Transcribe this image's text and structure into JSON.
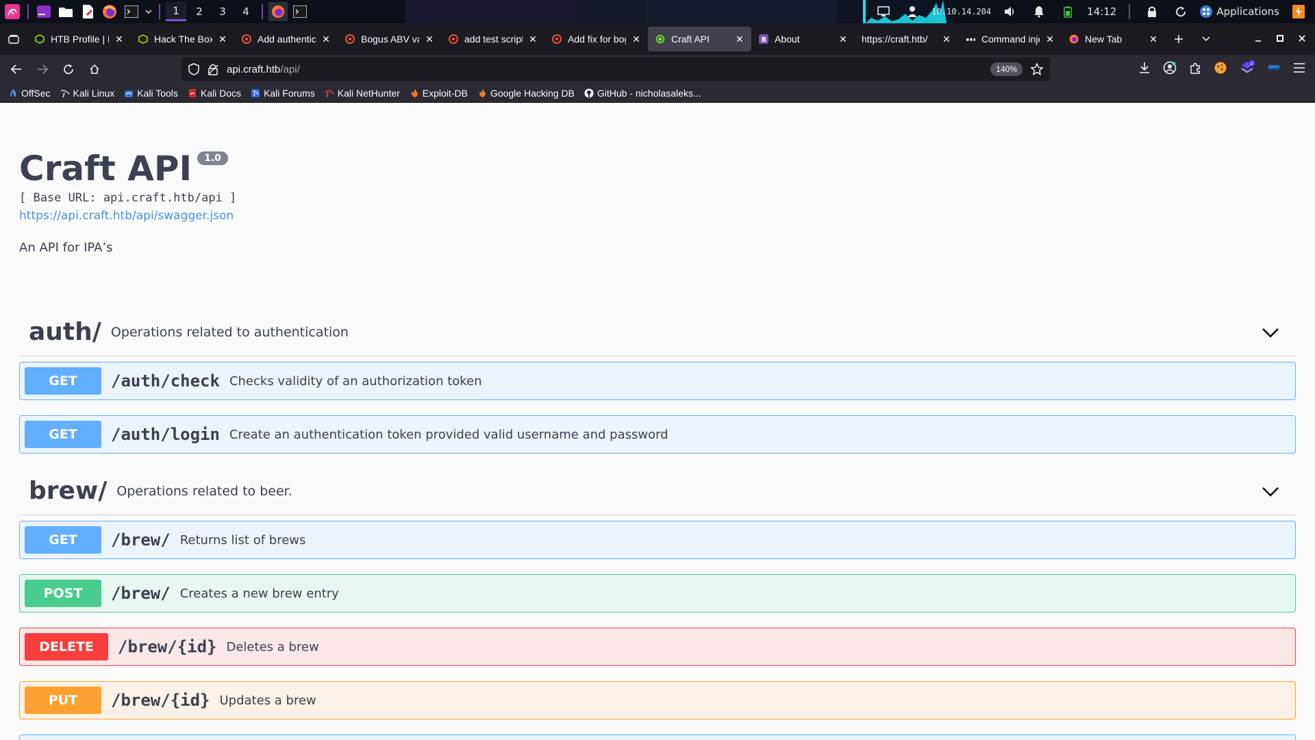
{
  "system_bar": {
    "workspaces": [
      "1",
      "2",
      "3",
      "4"
    ],
    "ip": "10.10.14.204",
    "time": "14:12",
    "apps_label": "Applications"
  },
  "tabs": [
    {
      "label": "HTB Profile | H",
      "icon": "cube-icon",
      "color": "#9fef00"
    },
    {
      "label": "Hack The Box :",
      "icon": "cube-icon",
      "color": "#9fef00"
    },
    {
      "label": "Add authentic",
      "icon": "gogs-icon",
      "color": "#f05133"
    },
    {
      "label": "Bogus ABV val",
      "icon": "gogs-icon",
      "color": "#f05133"
    },
    {
      "label": "add test script",
      "icon": "gogs-icon",
      "color": "#f05133"
    },
    {
      "label": "Add fix for bog",
      "icon": "gogs-icon",
      "color": "#f05133"
    },
    {
      "label": "Craft API",
      "icon": "swagger-icon",
      "color": "#85ea2d",
      "active": true
    },
    {
      "label": "About",
      "icon": "bootstrap-icon",
      "color": "#7952b3"
    },
    {
      "label": "https://craft.htb/",
      "icon": "",
      "color": ""
    },
    {
      "label": "Command inje",
      "icon": "site-icon",
      "color": "#ffffff"
    },
    {
      "label": "New Tab",
      "icon": "firefox-icon",
      "color": "#ff7139"
    }
  ],
  "url": {
    "host": "api.craft.htb",
    "path": "/api/"
  },
  "zoom": "140%",
  "bookmarks": [
    {
      "label": "OffSec",
      "icon": "offsec-icon"
    },
    {
      "label": "Kali Linux",
      "icon": "kali-icon"
    },
    {
      "label": "Kali Tools",
      "icon": "kali-tools-icon"
    },
    {
      "label": "Kali Docs",
      "icon": "kali-docs-icon"
    },
    {
      "label": "Kali Forums",
      "icon": "kali-forums-icon"
    },
    {
      "label": "Kali NetHunter",
      "icon": "nethunter-icon"
    },
    {
      "label": "Exploit-DB",
      "icon": "exploitdb-icon"
    },
    {
      "label": "Google Hacking DB",
      "icon": "ghdb-icon"
    },
    {
      "label": "GitHub - nicholasaleks...",
      "icon": "github-icon"
    }
  ],
  "api": {
    "title": "Craft API",
    "version": "1.0",
    "base_url": "[ Base URL: api.craft.htb/api ]",
    "spec_link": "https://api.craft.htb/api/swagger.json",
    "description": "An API for IPA’s"
  },
  "sections": [
    {
      "name": "auth/",
      "description": "Operations related to authentication",
      "operations": [
        {
          "method": "GET",
          "path": "/auth/check",
          "summary": "Checks validity of an authorization token"
        },
        {
          "method": "GET",
          "path": "/auth/login",
          "summary": "Create an authentication token provided valid username and password"
        }
      ]
    },
    {
      "name": "brew/",
      "description": "Operations related to beer.",
      "operations": [
        {
          "method": "GET",
          "path": "/brew/",
          "summary": "Returns list of brews"
        },
        {
          "method": "POST",
          "path": "/brew/",
          "summary": "Creates a new brew entry"
        },
        {
          "method": "DELETE",
          "path": "/brew/{id}",
          "summary": "Deletes a brew"
        },
        {
          "method": "PUT",
          "path": "/brew/{id}",
          "summary": "Updates a brew"
        }
      ]
    }
  ],
  "method_colors": {
    "GET": "#61affe",
    "POST": "#49cc90",
    "DELETE": "#f93e3e",
    "PUT": "#fca130"
  }
}
